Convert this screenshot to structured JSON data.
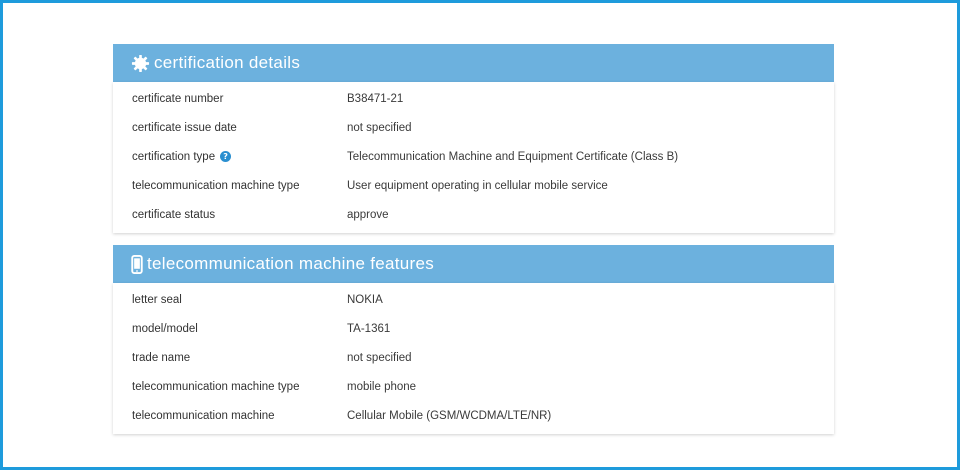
{
  "colors": {
    "frame_border": "#1e9bdc",
    "header_bg": "#6cb1de",
    "header_text": "#ffffff",
    "help_icon": "#2a8fd0"
  },
  "sections": [
    {
      "icon": "gear-icon",
      "title": "certification details",
      "rows": [
        {
          "label": "certificate number",
          "value": "B38471-21"
        },
        {
          "label": "certificate issue date",
          "value": "not specified"
        },
        {
          "label": "certification type",
          "value": "Telecommunication Machine and Equipment Certificate (Class B)",
          "help_icon": "question-icon"
        },
        {
          "label": "telecommunication machine type",
          "value": "User equipment operating in cellular mobile service"
        },
        {
          "label": "certificate status",
          "value": "approve"
        }
      ]
    },
    {
      "icon": "phone-icon",
      "title": "telecommunication machine features",
      "rows": [
        {
          "label": "letter seal",
          "value": "NOKIA"
        },
        {
          "label": "model/model",
          "value": "TA-1361"
        },
        {
          "label": "trade name",
          "value": "not specified"
        },
        {
          "label": "telecommunication machine type",
          "value": "mobile phone"
        },
        {
          "label": "telecommunication machine",
          "value": "Cellular Mobile (GSM/WCDMA/LTE/NR)"
        }
      ]
    }
  ]
}
